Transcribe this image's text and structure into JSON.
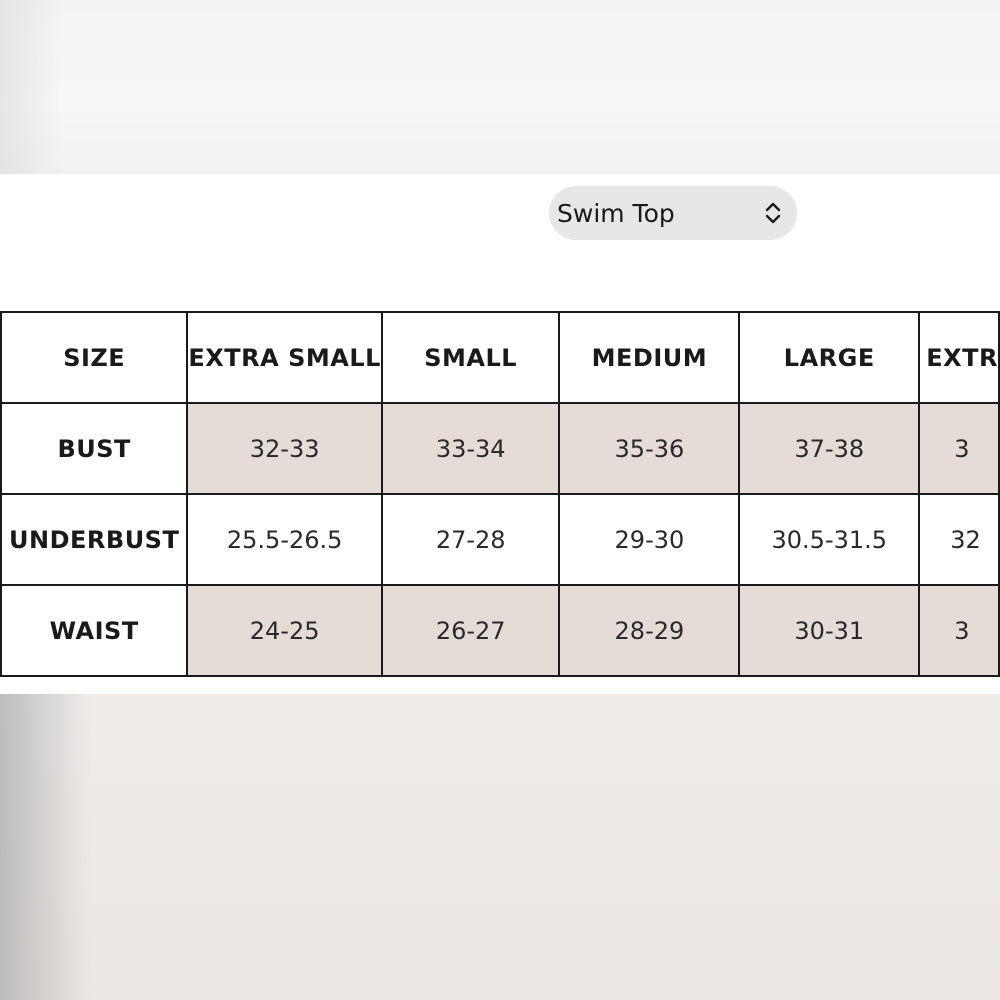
{
  "product_selector": {
    "selected": "Swim Top",
    "icon": "chevron-up-down-icon"
  },
  "size_chart": {
    "header": [
      "SIZE",
      "EXTRA SMALL",
      "SMALL",
      "MEDIUM",
      "LARGE",
      "EXTR"
    ],
    "rows": [
      {
        "label": "BUST",
        "values": [
          "32-33",
          "33-34",
          "35-36",
          "37-38",
          "3"
        ]
      },
      {
        "label": "UNDERBUST",
        "values": [
          "25.5-26.5",
          "27-28",
          "29-30",
          "30.5-31.5",
          "32"
        ]
      },
      {
        "label": "WAIST",
        "values": [
          "24-25",
          "26-27",
          "28-29",
          "30-31",
          "3"
        ]
      }
    ]
  },
  "colors": {
    "shaded_row": "#e5dcd7",
    "border": "#1a1a1a",
    "selector_bg": "#e7e7e7"
  }
}
